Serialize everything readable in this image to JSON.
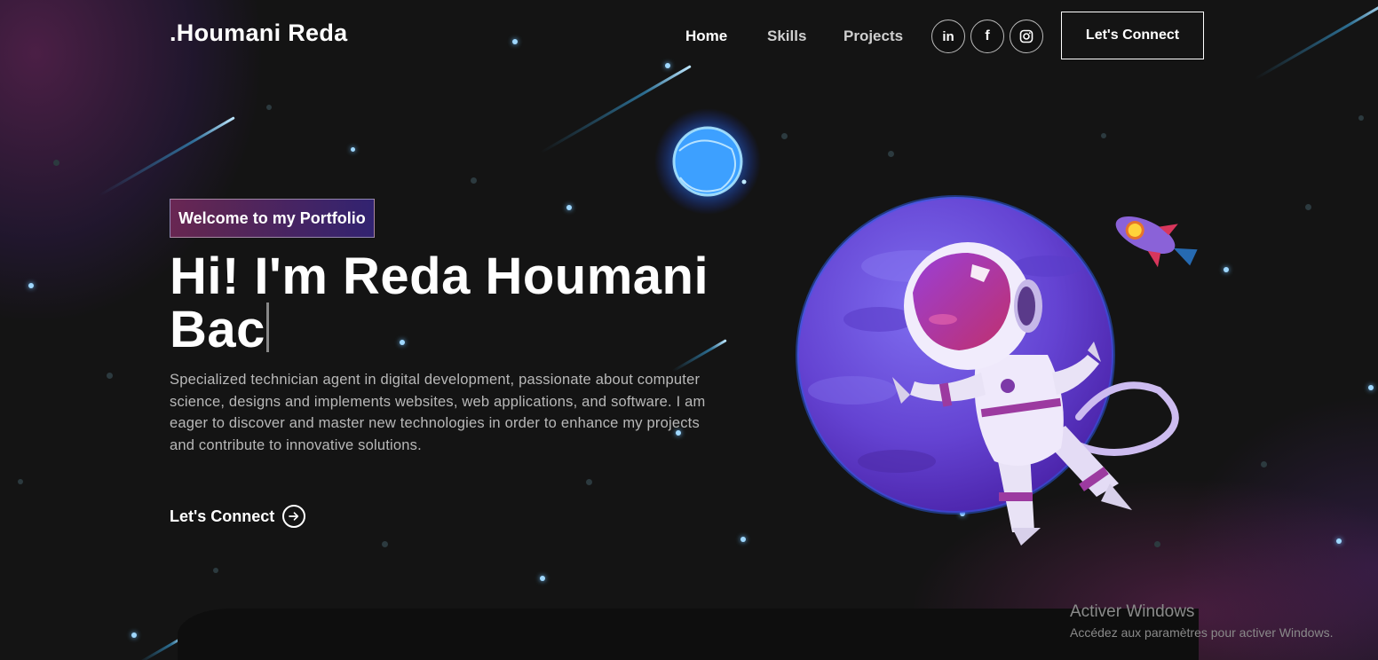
{
  "brand": {
    "logo": ".Houmani Reda"
  },
  "nav": {
    "links": [
      {
        "label": "Home",
        "active": true
      },
      {
        "label": "Skills",
        "active": false
      },
      {
        "label": "Projects",
        "active": false
      }
    ],
    "social_icons": [
      "linkedin-icon",
      "facebook-icon",
      "instagram-icon"
    ],
    "connect_label": "Let's Connect"
  },
  "hero": {
    "tagline": "Welcome to my Portfolio",
    "title_line1": "Hi! I'm Reda Houmani",
    "title_line2": "Bac",
    "description": "Specialized technician agent in digital development, passionate about computer science, designs and implements websites, web applications, and software. I am eager to discover and master new technologies in order to enhance my projects and contribute to innovative solutions.",
    "cta_label": "Let's Connect",
    "cta_icon": "arrow-right-circle-icon"
  },
  "illustration": {
    "subject": "astronaut-planet-rocket"
  },
  "os_watermark": {
    "title": "Activer Windows",
    "subtitle": "Accédez aux paramètres pour activer Windows."
  },
  "colors": {
    "background": "#121212",
    "accent_pink": "#aa367c",
    "accent_purple": "#4a2fbd",
    "planet": "#6a4fd8",
    "star_blue": "#9fd8ff"
  }
}
